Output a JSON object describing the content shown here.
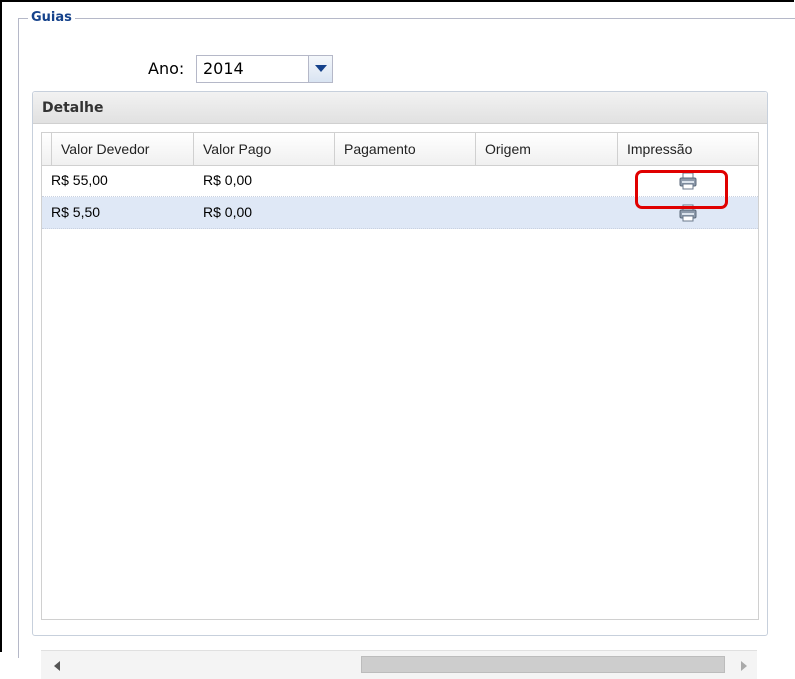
{
  "fieldset": {
    "legend": "Guias"
  },
  "year": {
    "label": "Ano:",
    "value": "2014"
  },
  "panel": {
    "title": "Detalhe"
  },
  "grid": {
    "columns": [
      "Valor Devedor",
      "Valor Pago",
      "Pagamento",
      "Origem",
      "Impressão"
    ],
    "rows": [
      {
        "valor_devedor": "R$ 55,00",
        "valor_pago": "R$ 0,00",
        "pagamento": "",
        "origem": "",
        "impressao_icon": "printer-icon"
      },
      {
        "valor_devedor": "R$ 5,50",
        "valor_pago": "R$ 0,00",
        "pagamento": "",
        "origem": "",
        "impressao_icon": "printer-icon"
      }
    ]
  },
  "colors": {
    "legend": "#15428b",
    "selected_row": "#dfe8f6",
    "highlight": "#e00000"
  }
}
